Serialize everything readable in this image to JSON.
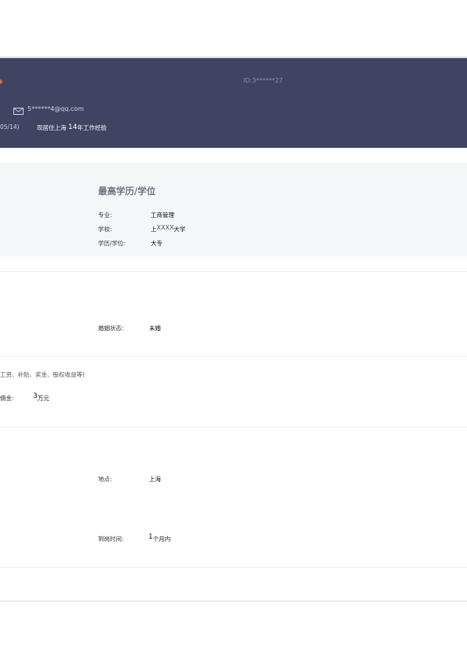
{
  "header": {
    "id_text": "ID:3******27",
    "email": "5******4@qq.com",
    "date_fragment": "05/14)",
    "experience": {
      "prefix": "现居住上海",
      "years": "14",
      "suffix": "年工作经验"
    }
  },
  "education": {
    "title": "最高学历/学位",
    "major": {
      "label": "专业:",
      "value": "工商管理"
    },
    "school": {
      "label": "学校:",
      "value_prefix": "上",
      "value_masked": "XXXX",
      "value_suffix": "大学"
    },
    "degree": {
      "label": "学历/学位:",
      "value": "大专"
    }
  },
  "personal": {
    "marital": {
      "label": "婚姻状态:",
      "value": "未婚"
    }
  },
  "salary": {
    "note": "工资、补贴、奖金、股权收益等)",
    "commission": {
      "label": "佣金:",
      "amount": "3",
      "unit": "万元"
    }
  },
  "intention": {
    "location": {
      "label": "地点:",
      "value": "上海"
    },
    "arrival": {
      "label": "到岗时间:",
      "amount": "1",
      "unit": "个月内"
    }
  },
  "colors": {
    "header_bg": "#404361",
    "edu_bg": "#f5f6f8",
    "accent": "#e8603a"
  }
}
